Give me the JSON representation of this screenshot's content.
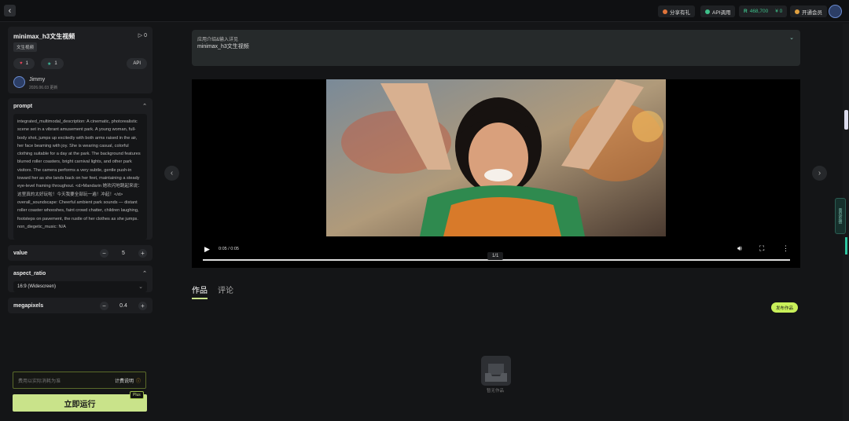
{
  "topbar": {
    "share_label": "分享有礼",
    "api_label": "API调用",
    "points": "468,700",
    "balance": "¥ 0",
    "member_label": "开通会员"
  },
  "model": {
    "title": "minimax_h3文生视频",
    "run_count": "0",
    "tag": "文生视频",
    "likes": "1",
    "stars": "1",
    "api_label": "API",
    "author": "Jimmy",
    "date": "2026.06.03 更新"
  },
  "prompt": {
    "label": "prompt",
    "text": "integrated_multimodal_description: A cinematic, photorealistic scene set in a vibrant amusement park. A young woman, full-body shot, jumps up excitedly with both arms raised in the air, her face beaming with joy. She is wearing casual, colorful clothing suitable for a day at the park. The background features blurred roller coasters, bright carnival lights, and other park visitors. The camera performs a very subtle, gentle push-in toward her as she lands back on her feet, maintaining a steady eye-level framing throughout. <d>Mandarin 她欢闪地跳起来说：这里真的太好玩啦！今天我要全部玩一遍！冲起！</d>\noverall_soundscape: Cheerful ambient park sounds — distant roller coaster whooshes, faint crowd chatter, children laughing, footsteps on pavement, the rustle of her clothes as she jumps.\nnon_diegetic_music: N/A"
  },
  "value_field": {
    "label": "value",
    "value": "5"
  },
  "aspect_ratio": {
    "label": "aspect_ratio",
    "selected": "16:9 (Widescreen)"
  },
  "megapixels": {
    "label": "megapixels",
    "value": "0.4"
  },
  "cost": {
    "placeholder": "费用以实际消耗为准",
    "link": "计费说明"
  },
  "run": {
    "label": "立即运行",
    "badge": "Plus"
  },
  "info": {
    "line1": "应用介绍&输入详见",
    "line2": "minimax_h3文生视频"
  },
  "video": {
    "time": "0:05 / 0:05",
    "counter": "1/1"
  },
  "tabs": {
    "works": "作品",
    "comments": "评论"
  },
  "publish_label": "发布作品",
  "empty_text": "暂无作品",
  "side_tab": "意见反馈",
  "colors": {
    "accent": "#c9e38a",
    "publish": "#c9f05a",
    "bg": "#141517",
    "panel": "#1d1e21"
  }
}
